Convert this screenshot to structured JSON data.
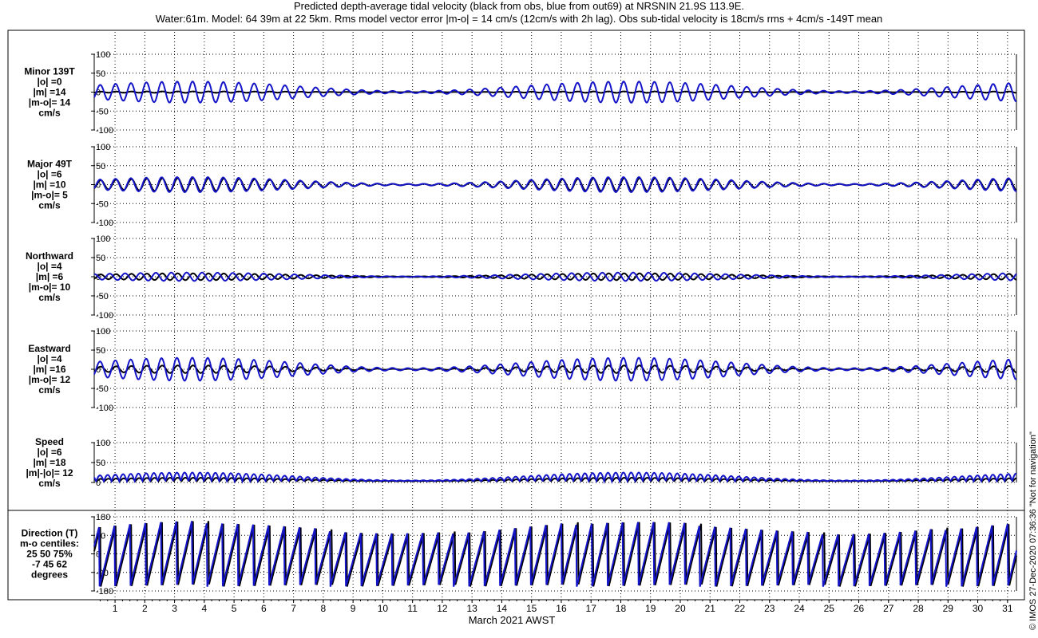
{
  "title_line1": "Predicted depth-average tidal velocity (black from obs, blue from out69) at NRSNIN 21.9S 113.9E.",
  "title_line2": "Water:61m. Model: 64 39m at 22 5km. Rms model vector error |m-o| = 14 cm/s (12cm/s with 2h lag). Obs sub-tidal velocity is 18cm/s rms + 4cm/s -149T mean",
  "credit": "© IMOS 27-Dec-2020 07:36:36  \"Not for navigation\"",
  "chart_data": {
    "type": "line",
    "xlabel": "March 2021 AWST",
    "x_ticks": [
      "1",
      "2",
      "3",
      "4",
      "5",
      "6",
      "7",
      "8",
      "9",
      "10",
      "11",
      "12",
      "13",
      "14",
      "15",
      "16",
      "17",
      "18",
      "19",
      "20",
      "21",
      "22",
      "23",
      "24",
      "25",
      "26",
      "27",
      "28",
      "29",
      "30",
      "31"
    ],
    "xlim": [
      0.3,
      31.3
    ],
    "grid": true,
    "series_colors": {
      "obs": "#000000",
      "model": "#1414c8"
    },
    "panels": [
      {
        "id": "minor",
        "label_lines": [
          "Minor 139T",
          "|o| =0",
          "|m| =14",
          "|m-o|= 14",
          "cm/s"
        ],
        "ylim": [
          -100,
          100
        ],
        "y_ticks": [
          100,
          50,
          0,
          -50,
          -100
        ],
        "y_tick_labels": [
          "100",
          "50",
          "0",
          "-50",
          "-100"
        ],
        "series": [
          {
            "key": "obs",
            "amplitude": 2,
            "phase": 0.0
          },
          {
            "key": "model",
            "amplitude": 28,
            "phase": 0.2
          }
        ]
      },
      {
        "id": "major",
        "label_lines": [
          "Major 49T",
          "|o| =6",
          "|m| =10",
          "|m-o|= 5",
          "cm/s"
        ],
        "ylim": [
          -100,
          100
        ],
        "y_ticks": [
          100,
          50,
          0,
          -50,
          -100
        ],
        "y_tick_labels": [
          "100",
          "50",
          "0",
          "-50",
          "-100"
        ],
        "series": [
          {
            "key": "obs",
            "amplitude": 17,
            "phase": 0.0
          },
          {
            "key": "model",
            "amplitude": 20,
            "phase": 0.25
          }
        ]
      },
      {
        "id": "north",
        "label_lines": [
          "Northward",
          "|o| =4",
          "|m| =6",
          "|m-o|= 10",
          "cm/s"
        ],
        "ylim": [
          -100,
          100
        ],
        "y_ticks": [
          100,
          50,
          0,
          -50,
          -100
        ],
        "y_tick_labels": [
          "100",
          "50",
          "0",
          "-50",
          "-100"
        ],
        "series": [
          {
            "key": "obs",
            "amplitude": 9,
            "phase": 0.0
          },
          {
            "key": "model",
            "amplitude": 11,
            "phase": 2.6
          }
        ]
      },
      {
        "id": "east",
        "label_lines": [
          "Eastward",
          "|o| =4",
          "|m| =16",
          "|m-o|= 12",
          "cm/s"
        ],
        "ylim": [
          -100,
          100
        ],
        "y_ticks": [
          100,
          50,
          0,
          -50,
          -100
        ],
        "y_tick_labels": [
          "100",
          "50",
          "0",
          "-50",
          "-100"
        ],
        "series": [
          {
            "key": "obs",
            "amplitude": 10,
            "phase": 0.0
          },
          {
            "key": "model",
            "amplitude": 30,
            "phase": 0.3
          }
        ]
      },
      {
        "id": "speed",
        "label_lines": [
          "Speed",
          "|o| =6",
          "|m| =18",
          "|m|-|o|= 12",
          "cm/s"
        ],
        "ylim": [
          -100,
          100
        ],
        "y_ticks": [
          100,
          50,
          0
        ],
        "y_tick_labels": [
          "100",
          "50",
          "0"
        ],
        "series": [
          {
            "key": "obs",
            "amplitude": 9,
            "phase": 0.0
          },
          {
            "key": "model",
            "amplitude": 22,
            "phase": 0.3
          }
        ]
      },
      {
        "id": "direction",
        "label_lines": [
          "Direction (T)",
          "m-o centiles:",
          "25  50  75%",
          "-7  45  62",
          "degrees"
        ],
        "ylim": [
          -180,
          180
        ],
        "y_ticks": [
          180,
          90,
          0,
          -90,
          -180
        ],
        "y_tick_labels": [
          "180",
          "90",
          "0",
          "-90",
          "-180"
        ],
        "series": [
          {
            "key": "obs",
            "amplitude": 0,
            "phase": 0.0
          },
          {
            "key": "model",
            "amplitude": 0,
            "phase": 0.3
          }
        ]
      }
    ]
  }
}
